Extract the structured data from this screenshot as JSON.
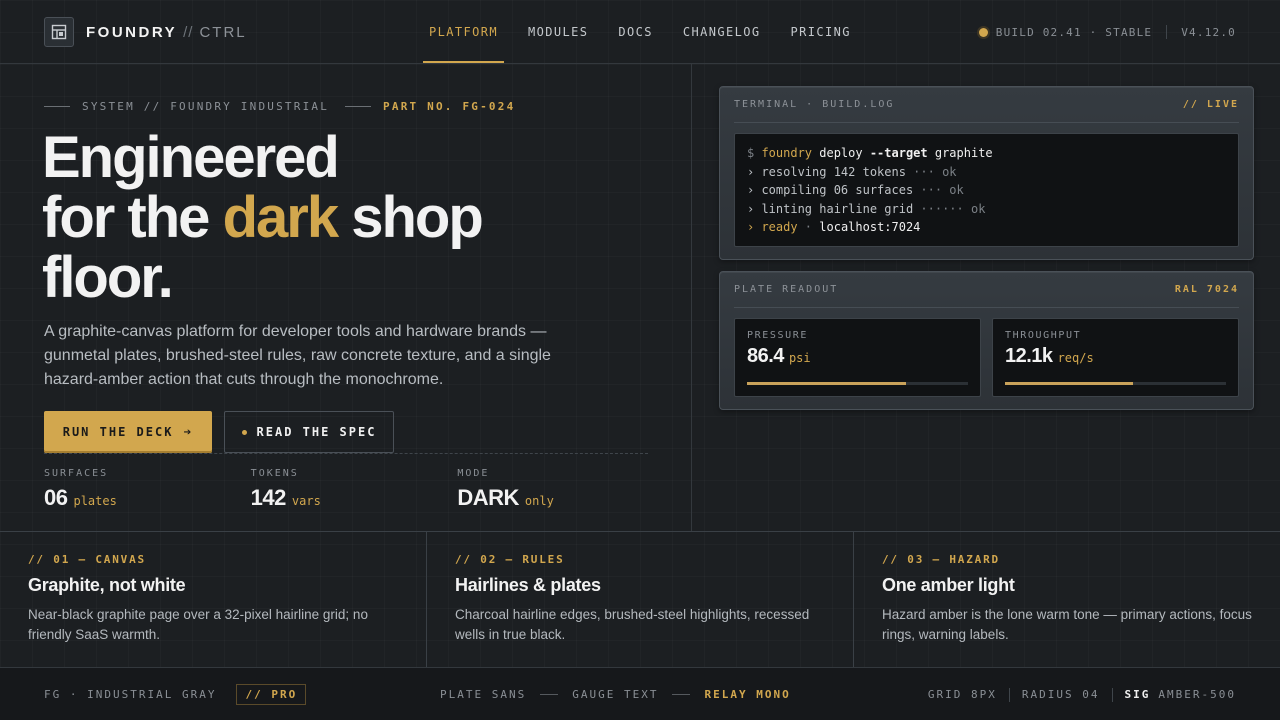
{
  "nav": {
    "brand": {
      "name": "FOUNDRY",
      "separator": "//",
      "suffix": "CTRL",
      "icon": "panel-layout-icon"
    },
    "links": [
      {
        "label": "PLATFORM",
        "active": true
      },
      {
        "label": "MODULES",
        "active": false
      },
      {
        "label": "DOCS",
        "active": false
      },
      {
        "label": "CHANGELOG",
        "active": false
      },
      {
        "label": "PRICING",
        "active": false
      }
    ],
    "build": "BUILD 02.41 · STABLE",
    "version": "V4.12.0"
  },
  "hero": {
    "eyebrow": {
      "system": "SYSTEM // FOUNDRY INDUSTRIAL",
      "part": "PART NO. FG-024"
    },
    "headline": {
      "line1": "Engineered",
      "line2_pre": "for the",
      "line2_accent": "dark",
      "line2_post": "shop",
      "line3": "floor."
    },
    "lead": "A graphite-canvas platform for developer tools and hardware brands — gunmetal plates, brushed-steel rules, raw concrete texture, and a single hazard-amber action that cuts through the monochrome.",
    "primary_cta": "RUN THE DECK",
    "secondary_cta": "READ THE SPEC",
    "stats": [
      {
        "label": "SURFACES",
        "value": "06",
        "unit": "plates"
      },
      {
        "label": "TOKENS",
        "value": "142",
        "unit": "vars"
      },
      {
        "label": "MODE",
        "value": "DARK",
        "unit": "only"
      }
    ]
  },
  "terminal": {
    "title": "TERMINAL · BUILD.LOG",
    "tag": "// LIVE",
    "lines": {
      "l1_prompt": "$ ",
      "l1_cmd": "foundry",
      "l1_sub": " deploy ",
      "l1_flag": "--target",
      "l1_arg": " graphite",
      "l2": "› resolving 142 tokens",
      "l2_dots": " ··· ",
      "l2_ok": "ok",
      "l3": "› compiling 06 surfaces",
      "l3_dots": " ··· ",
      "l3_ok": "ok",
      "l4": "› linting hairline grid",
      "l4_dots": " ······ ",
      "l4_ok": "ok",
      "l5_ready": "› ready",
      "l5_sep": " · ",
      "l5_host": "localhost:7024"
    }
  },
  "readout": {
    "title": "PLATE READOUT",
    "tag": "RAL 7024",
    "gauges": [
      {
        "label": "PRESSURE",
        "value": "86.4",
        "unit": "psi",
        "level": 0.72
      },
      {
        "label": "THROUGHPUT",
        "value": "12.1k",
        "unit": "req/s",
        "level": 0.58
      }
    ]
  },
  "features": [
    {
      "code": "// 01 — CANVAS",
      "title": "Graphite, not white",
      "text": "Near-black graphite page over a 32-pixel hairline grid; no friendly SaaS warmth."
    },
    {
      "code": "// 02 — RULES",
      "title": "Hairlines & plates",
      "text": "Charcoal hairline edges, brushed-steel highlights, recessed wells in true black."
    },
    {
      "code": "// 03 — HAZARD",
      "title": "One amber light",
      "text": "Hazard amber is the lone warm tone — primary actions, focus rings, warning labels."
    }
  ],
  "footer": {
    "left": "FG · INDUSTRIAL GRAY",
    "badge": "// PRO",
    "fonts": [
      "PLATE SANS",
      "GAUGE TEXT",
      "RELAY MONO"
    ],
    "grid": "GRID 8PX",
    "radius": "RADIUS 04",
    "sig_label": "SIG",
    "sig_value": "AMBER-500"
  },
  "colors": {
    "accent": "#d2a74e",
    "background": "#1c1f22",
    "well": "#101214",
    "plate": "#353b41"
  }
}
